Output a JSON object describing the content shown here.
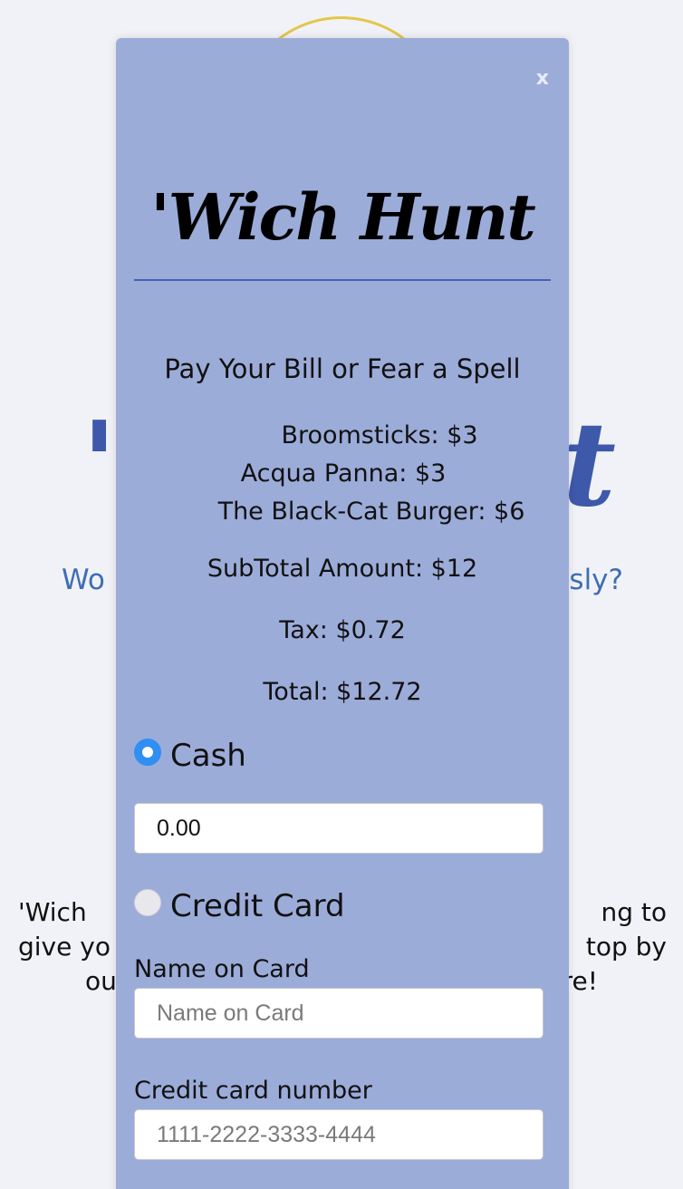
{
  "background": {
    "title_left": "'C",
    "title_right": "t",
    "tagline_left": "Wo",
    "tagline_right": "sly?",
    "body_lines": [
      {
        "left": "'Wich",
        "right": "ng to"
      },
      {
        "left": "give yo",
        "right": "top by"
      },
      {
        "left": "ou",
        "right": "re!"
      }
    ]
  },
  "modal": {
    "close_label": "x",
    "brand": "'Wich Hunt",
    "heading": "Pay Your Bill or Fear a Spell",
    "items": [
      "Broomsticks: $3",
      "Acqua Panna: $3",
      "The Black-Cat Burger: $6"
    ],
    "subtotal": "SubTotal Amount: $12",
    "tax": "Tax: $0.72",
    "total": "Total: $12.72",
    "payment": {
      "cash_label": "Cash",
      "cash_selected": true,
      "cash_value": "0.00",
      "card_label": "Credit Card",
      "card_selected": false,
      "name_label": "Name on Card",
      "name_placeholder": "Name on Card",
      "number_label": "Credit card number",
      "number_placeholder": "1111-2222-3333-4444"
    }
  },
  "colors": {
    "modal_bg": "#9cacd9",
    "brand_rule": "#4460b6",
    "radio_checked": "#2f8ff3",
    "background_title": "#3e59aa",
    "background_tagline": "#3e6eb4",
    "logo_ring": "#e2c74a"
  }
}
